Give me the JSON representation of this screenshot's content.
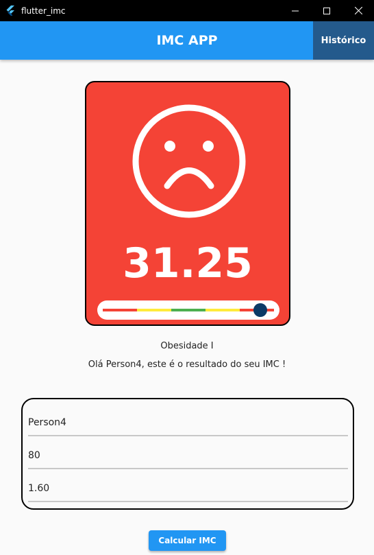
{
  "window": {
    "title": "flutter_imc",
    "minimize_icon": "minimize-icon",
    "maximize_icon": "maximize-icon",
    "close_icon": "close-icon"
  },
  "appbar": {
    "title": "IMC APP",
    "history_label": "Histórico",
    "color": "#2196f3"
  },
  "result": {
    "card_color": "#f44336",
    "face_icon": "sad-face-icon",
    "bmi_value": "31.25",
    "scale_level": 0.92,
    "scale_colors": [
      "#f44336",
      "#ffeb3b",
      "#4caf50",
      "#ffeb3b",
      "#f44336"
    ],
    "category": "Obesidade I",
    "message": "Olá Person4, este é o resultado do seu IMC !"
  },
  "form": {
    "name_value": "Person4",
    "weight_value": "80",
    "height_value": "1.60"
  },
  "calculate_label": "Calcular IMC"
}
